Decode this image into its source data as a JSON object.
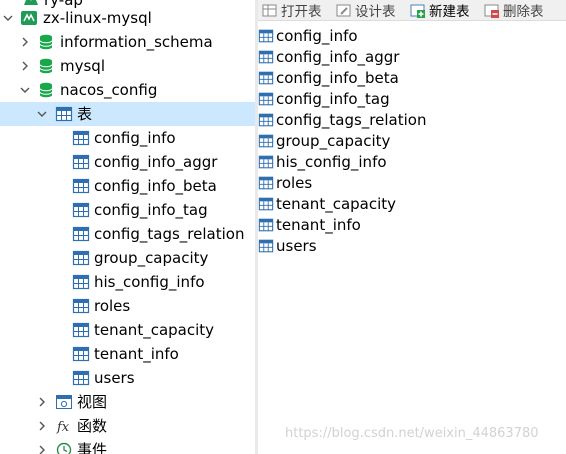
{
  "tree": {
    "partial_top_label": "ry-ap",
    "connection": "zx-linux-mysql",
    "databases": [
      "information_schema",
      "mysql",
      "nacos_config"
    ],
    "tables_node": "表",
    "tables": [
      "config_info",
      "config_info_aggr",
      "config_info_beta",
      "config_info_tag",
      "config_tags_relation",
      "group_capacity",
      "his_config_info",
      "roles",
      "tenant_capacity",
      "tenant_info",
      "users"
    ],
    "other_nodes": [
      "视图",
      "函数",
      "事件"
    ]
  },
  "toolbar": {
    "open_table": "打开表",
    "design_table": "设计表",
    "new_table": "新建表",
    "delete_table": "删除表"
  },
  "object_list": [
    "config_info",
    "config_info_aggr",
    "config_info_beta",
    "config_info_tag",
    "config_tags_relation",
    "group_capacity",
    "his_config_info",
    "roles",
    "tenant_capacity",
    "tenant_info",
    "users"
  ],
  "watermark": "https://blog.csdn.net/weixin_44863780",
  "colors": {
    "selected_row": "#cce8ff",
    "db_icon": "#18a84a",
    "table_icon": "#2f6fb0"
  }
}
